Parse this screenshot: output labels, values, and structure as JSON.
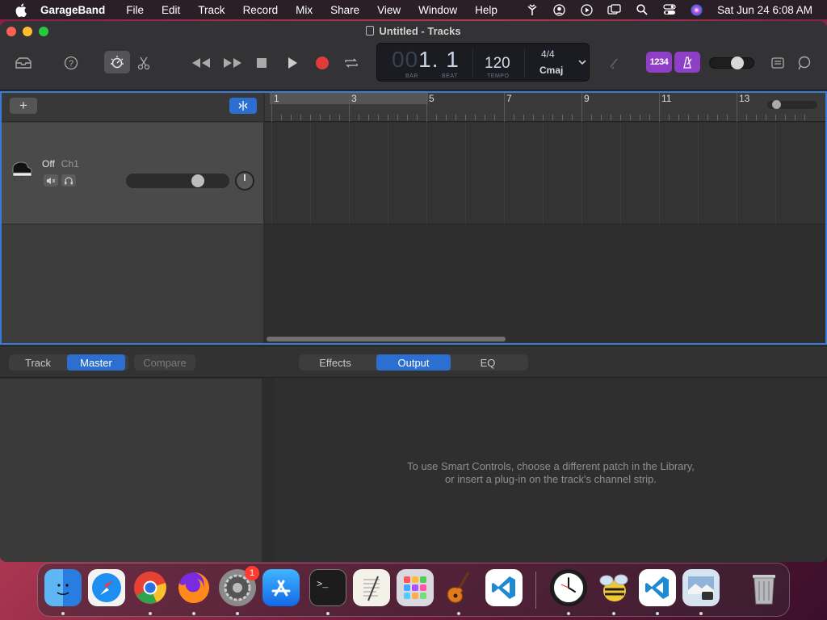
{
  "menubar": {
    "app_name": "GarageBand",
    "items": [
      "File",
      "Edit",
      "Track",
      "Record",
      "Mix",
      "Share",
      "View",
      "Window",
      "Help"
    ],
    "clock": "Sat Jun 24  6:08 AM"
  },
  "window": {
    "title": "Untitled - Tracks"
  },
  "lcd": {
    "position_dim": "00",
    "position": "1. 1",
    "bar_label": "BAR",
    "beat_label": "BEAT",
    "tempo": "120",
    "tempo_label": "TEMPO",
    "time_signature": "4/4",
    "key": "Cmaj"
  },
  "toolbar": {
    "count_in_label": "1234"
  },
  "track": {
    "name": "Off",
    "channel": "Ch1",
    "volume_level": 0.72
  },
  "ruler": {
    "bars": [
      "1",
      "3",
      "5",
      "7",
      "9",
      "11",
      "13"
    ]
  },
  "smart_controls": {
    "left_tabs": [
      "Track",
      "Master",
      "Compare"
    ],
    "left_selected": "Master",
    "right_tabs": [
      "Effects",
      "Output",
      "EQ"
    ],
    "right_selected": "Output",
    "message_line1": "To use Smart Controls, choose a different patch in the Library,",
    "message_line2": "or insert a plug-in on the track's channel strip."
  },
  "dock": {
    "apps": [
      "finder-icon",
      "safari-icon",
      "chrome-icon",
      "firefox-icon",
      "system-settings-icon",
      "app-store-icon",
      "terminal-icon",
      "textedit-icon",
      "launchpad-icon",
      "garageband-icon",
      "vscode-icon",
      "clock-icon",
      "cyberduck-icon",
      "vscode-icon",
      "preview-icon",
      "trash-icon"
    ],
    "settings_badge": "1"
  },
  "colors": {
    "accent": "#2d6fd0",
    "record": "#e23b3b",
    "purple": "#8e3fc5"
  }
}
